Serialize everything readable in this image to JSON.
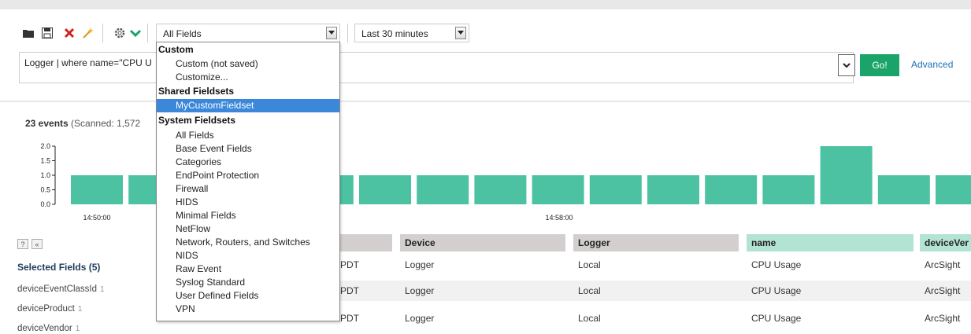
{
  "toolbar": {
    "icons": [
      "folder-icon",
      "save-icon",
      "delete-icon",
      "wand-icon",
      "gear-icon",
      "check-icon"
    ],
    "fieldset_select": "All Fields",
    "time_select": "Last 30 minutes"
  },
  "query": {
    "text": "Logger | where name=\"CPU U",
    "go_label": "Go!",
    "advanced_label": "Advanced"
  },
  "summary": {
    "events": "23 events",
    "scanned": "(Scanned: 1,572"
  },
  "chart_data": {
    "type": "bar",
    "y_ticks": [
      "2.0",
      "1.5",
      "1.0",
      "0.5",
      "0.0"
    ],
    "ylim": [
      0,
      2
    ],
    "time_labels": [
      "14:50:00",
      "14:58:00"
    ],
    "values": [
      1,
      1,
      1,
      1,
      1,
      1,
      1,
      1,
      1,
      1,
      1,
      1,
      1,
      2,
      1,
      1,
      1
    ],
    "bar_color": "#4dc2a2"
  },
  "fields_panel": {
    "help_btn": "?",
    "collapse_btn": "«",
    "title": "Selected Fields (5)",
    "items": [
      {
        "name": "deviceEventClassId",
        "count": "1"
      },
      {
        "name": "deviceProduct",
        "count": "1"
      },
      {
        "name": "deviceVendor",
        "count": "1"
      }
    ]
  },
  "table": {
    "columns": [
      {
        "label": "Device",
        "color": "#d4cfcf"
      },
      {
        "label": "Logger",
        "color": "#d4cfcf"
      },
      {
        "label": "name",
        "color": "#b3e3d2"
      },
      {
        "label": "deviceVer",
        "color": "#b3e3d2"
      }
    ],
    "rows": [
      {
        "time": "PDT",
        "device": "Logger",
        "logger": "Local",
        "name": "CPU Usage",
        "vendor": "ArcSight"
      },
      {
        "time": "PDT",
        "device": "Logger",
        "logger": "Local",
        "name": "CPU Usage",
        "vendor": "ArcSight"
      },
      {
        "time": "PDT",
        "device": "Logger",
        "logger": "Local",
        "name": "CPU Usage",
        "vendor": "ArcSight"
      }
    ]
  },
  "dropdown": {
    "groups": {
      "custom": "Custom",
      "shared": "Shared Fieldsets",
      "system": "System Fieldsets"
    },
    "custom_items": [
      "Custom (not saved)",
      "Customize..."
    ],
    "shared_items": [
      "MyCustomFieldset"
    ],
    "system_items": [
      "All Fields",
      "Base Event Fields",
      "Categories",
      "EndPoint Protection",
      "Firewall",
      "HIDS",
      "Minimal Fields",
      "NetFlow",
      "Network, Routers, and Switches",
      "NIDS",
      "Raw Event",
      "Syslog Standard",
      "User Defined Fields",
      "VPN"
    ]
  }
}
